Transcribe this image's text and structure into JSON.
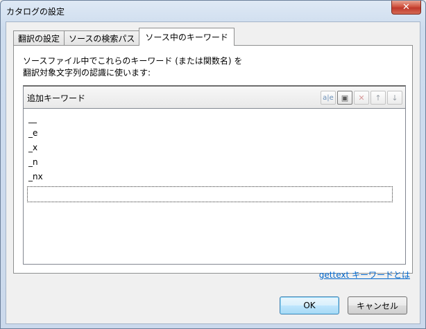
{
  "window": {
    "title": "カタログの設定",
    "close_label": "✕"
  },
  "tabs": [
    {
      "label": "翻訳の設定"
    },
    {
      "label": "ソースの検索パス"
    },
    {
      "label": "ソース中のキーワード",
      "active": true
    }
  ],
  "panel": {
    "description_line1": "ソースファイル中でこれらのキーワード (または関数名) を",
    "description_line2": "翻訳対象文字列の認識に使います:",
    "list_title": "追加キーワード",
    "toolbar": {
      "edit_icon": "a|e",
      "add_icon": "▣",
      "delete_icon": "✕",
      "up_icon": "↑",
      "down_icon": "↓"
    },
    "keywords": [
      "__",
      "_e",
      "_x",
      "_n",
      "_nx"
    ],
    "new_keyword_value": ""
  },
  "help_link": "gettext キーワードとは",
  "buttons": {
    "ok": "OK",
    "cancel": "キャンセル"
  }
}
